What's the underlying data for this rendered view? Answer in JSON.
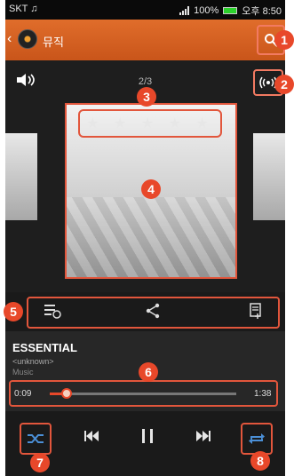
{
  "status": {
    "carrier": "SKT ♫",
    "battery": "100%",
    "time": "오후 8:50"
  },
  "appbar": {
    "title": "뮤직"
  },
  "player": {
    "position": "2/3",
    "rating": "★ ★ ★ ★ ★",
    "song": "ESSENTIAL",
    "artist": "<unknown>",
    "album": "Music",
    "elapsed": "0:09",
    "duration": "1:38",
    "progress_fraction": 0.09
  },
  "callouts": [
    "1",
    "2",
    "3",
    "4",
    "5",
    "6",
    "7",
    "8"
  ],
  "colors": {
    "accent": "#e8482a",
    "appbar": "#d9622a"
  },
  "icons": {
    "volume": "speaker-icon",
    "cast": "cast-icon",
    "search": "search-icon",
    "playlist_add": "playlist-add-icon",
    "share": "share-icon",
    "details": "details-icon",
    "shuffle": "shuffle-icon",
    "prev": "previous-icon",
    "pause": "pause-icon",
    "next": "next-icon",
    "repeat": "repeat-icon"
  }
}
